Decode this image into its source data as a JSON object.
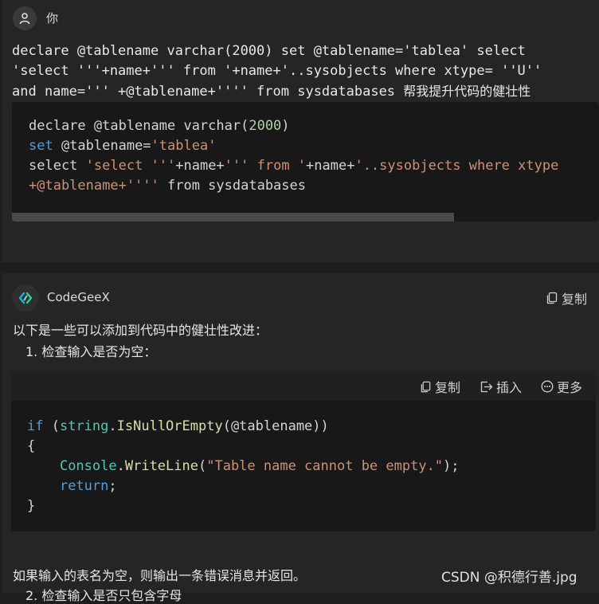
{
  "user": {
    "name": "你",
    "text_lines": [
      "declare @tablename varchar(2000) set @tablename='tablea' select",
      "'select '''+name+''' from '+name+'..sysobjects where xtype= ''U''",
      "and name=''' +@tablename+'''' from sysdatabases "
    ],
    "text_cjk": "帮我提升代码的健壮性",
    "code": {
      "line1_a": "declare @tablename varchar(",
      "line1_num": "2000",
      "line1_b": ")",
      "line2_kw": "set",
      "line2_a": " @tablename=",
      "line2_str": "'tablea'",
      "line3_a": "select ",
      "line3_str1": "'select '''",
      "line3_b": "+name+",
      "line3_str2": "''' from '",
      "line3_c": "+name+",
      "line3_str3": "'..sysobjects where xtype",
      "line4_str": "+@tablename+''''",
      "line4_a": " from sysdatabases"
    }
  },
  "assistant": {
    "name": "CodeGeeX",
    "copy_label": "复制",
    "intro": "以下是一些可以添加到代码中的健壮性改进：",
    "step1": "1. 检查输入是否为空：",
    "toolbar": {
      "copy": "复制",
      "insert": "插入",
      "more": "更多"
    },
    "code": {
      "l1_kw": "if",
      "l1_a": " (",
      "l1_ty": "string",
      "l1_b": ".",
      "l1_fn": "IsNullOrEmpty",
      "l1_c": "(@tablename))",
      "l2": "{",
      "l3_pre": "    ",
      "l3_ty": "Console",
      "l3_a": ".",
      "l3_fn": "WriteLine",
      "l3_b": "(",
      "l3_str": "\"Table name cannot be empty.\"",
      "l3_c": ");",
      "l4_pre": "    ",
      "l4_kw": "return",
      "l4_a": ";",
      "l5": "}"
    },
    "after_text": "如果输入的表名为空，则输出一条错误消息并返回。",
    "step2": "2. 检查输入是否只包含字母"
  },
  "watermark": "CSDN @积德行善.jpg",
  "icons": {
    "user_avatar": "person-icon",
    "bot_avatar": "codegeex-logo-icon",
    "copy": "copy-icon",
    "insert": "insert-icon",
    "more": "more-icon"
  }
}
